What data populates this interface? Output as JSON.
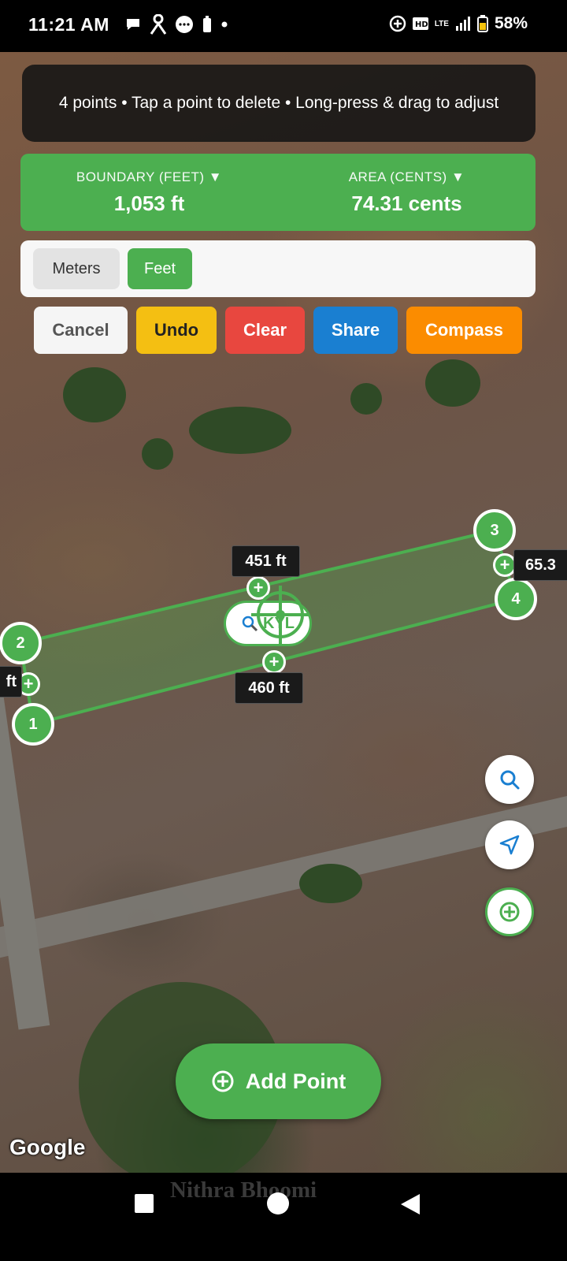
{
  "status_bar": {
    "time": "11:21 AM",
    "battery": "58%",
    "network": "LTE"
  },
  "hint": {
    "text": "4 points • Tap a point to delete • Long-press & drag to adjust"
  },
  "measurements": {
    "boundary_label": "BOUNDARY (FEET) ▼",
    "boundary_value": "1,053 ft",
    "area_label": "AREA (CENTS) ▼",
    "area_value": "74.31 cents"
  },
  "units": {
    "meters": "Meters",
    "feet": "Feet",
    "selected": "Feet"
  },
  "actions": {
    "cancel": "Cancel",
    "undo": "Undo",
    "clear": "Clear",
    "share": "Share",
    "compass": "Compass"
  },
  "polygon": {
    "vertices": [
      "1",
      "2",
      "3",
      "4"
    ],
    "edge_labels": {
      "top": "451 ft",
      "bottom": "460 ft",
      "right": "65.3",
      "left": "ft"
    }
  },
  "place_label": "KYL",
  "add_point_label": "Add Point",
  "map_attribution": "Google",
  "watermark": "Nithra Bhoomi",
  "icons": {
    "search": "search-icon",
    "navigate": "navigation-arrow-icon",
    "locate": "crosshair-target-icon",
    "add": "plus-circle-icon"
  },
  "colors": {
    "primary_green": "#4caf50",
    "undo": "#f4bf12",
    "clear": "#e8473f",
    "share": "#1a7fd1",
    "compass": "#fb8c00"
  }
}
